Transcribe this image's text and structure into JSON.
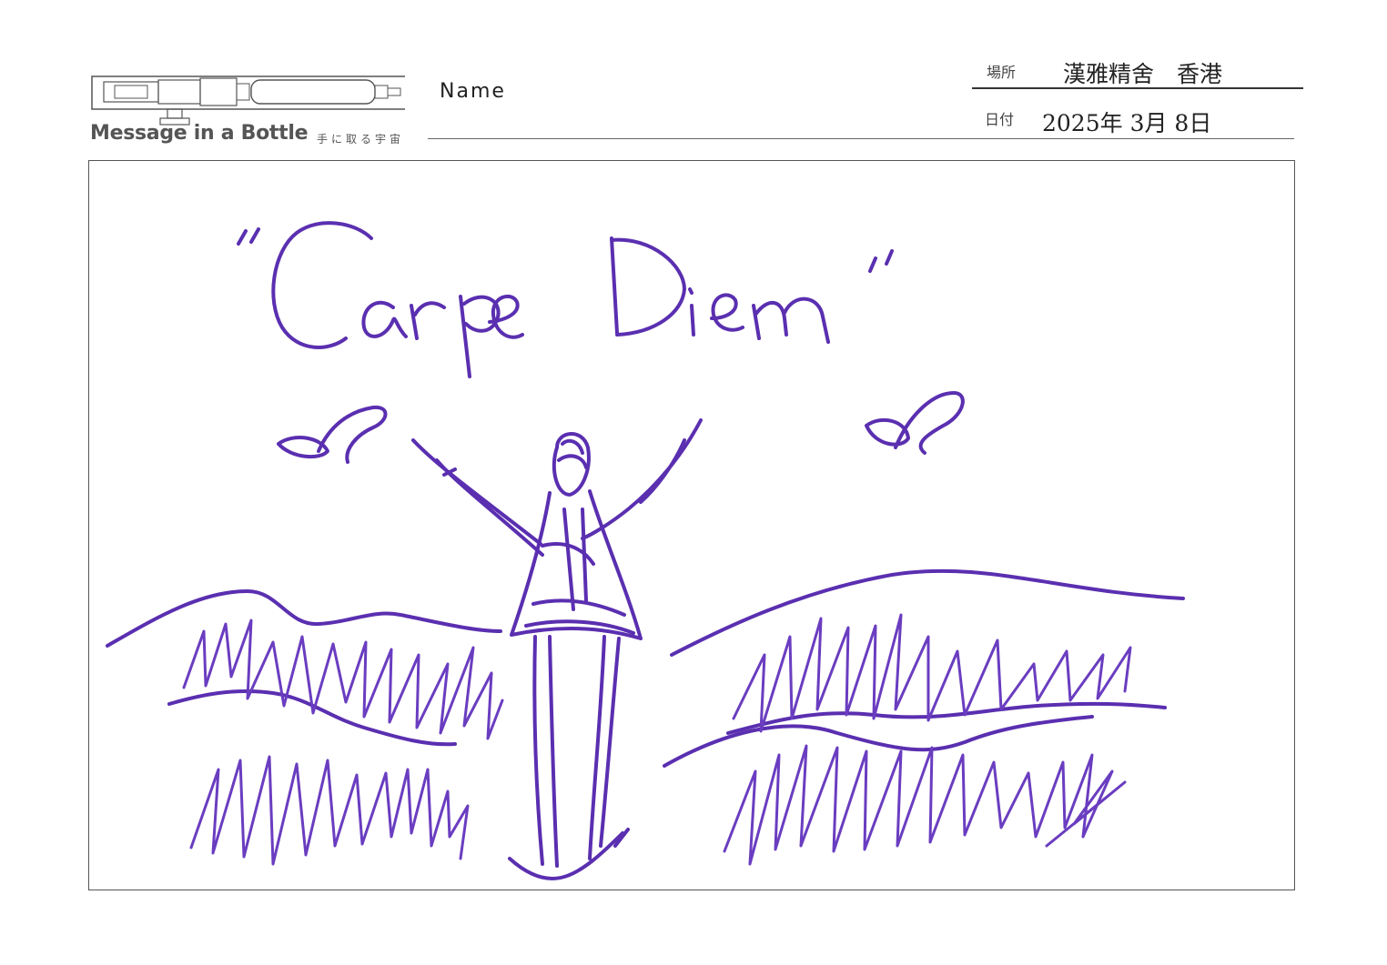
{
  "header": {
    "brand_title": "Message in a Bottle",
    "brand_subtitle": "手に取る宇宙",
    "name_label": "Name",
    "place_label": "場所",
    "place_value": "漢雅精舍　香港",
    "date_label": "日付",
    "date_value": "2025年 3月 8日"
  },
  "message": {
    "handwritten_text": "\"Carpe Diem\""
  },
  "colors": {
    "ink": "#5a2fb0",
    "frame": "#555555"
  }
}
